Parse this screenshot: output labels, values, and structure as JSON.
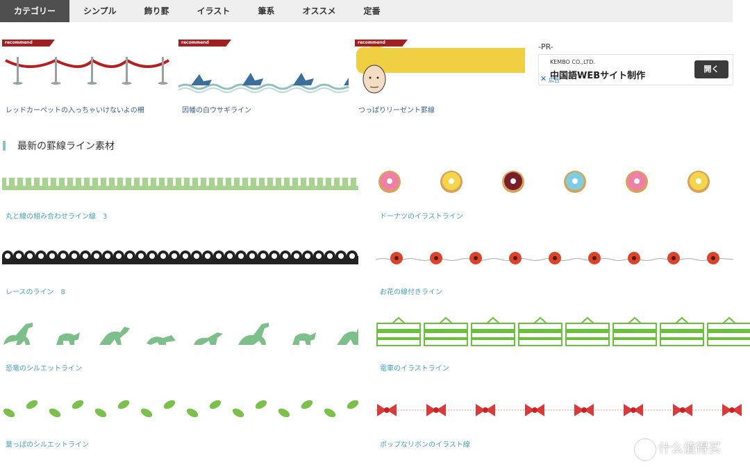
{
  "nav": {
    "items": [
      {
        "label": "カテゴリー",
        "active": true
      },
      {
        "label": "シンプル"
      },
      {
        "label": "飾り罫"
      },
      {
        "label": "イラスト"
      },
      {
        "label": "筆系"
      },
      {
        "label": "オススメ"
      },
      {
        "label": "定番"
      }
    ]
  },
  "recommended": {
    "badge": "recommend",
    "items": [
      {
        "title": "レッドカーペットの入っちゃいけないよの柵"
      },
      {
        "title": "因幡の白ウサギライン"
      },
      {
        "title": "つっぱりリーゼント罫線"
      }
    ]
  },
  "pr": {
    "label": "-PR-",
    "company": "KEMBO CO.,LTD.",
    "headline": "中国語WEBサイト制作",
    "open_button": "開く",
    "ad_label": "広告"
  },
  "section": {
    "title": "最新の罫線ライン素材"
  },
  "lines": [
    {
      "title": "丸と線の組み合わせライン線　3",
      "icon": "scallop-line",
      "color": "#a8d28f"
    },
    {
      "title": "ドーナツのイラストライン",
      "icon": "donut-line"
    },
    {
      "title": "レースのライン　8",
      "icon": "lace-line",
      "color": "#222222"
    },
    {
      "title": "お花の線付きライン",
      "icon": "flower-line",
      "color": "#d9442b"
    },
    {
      "title": "恐竜のシルエットライン",
      "icon": "dinosaur-line",
      "color": "#7dbf8a"
    },
    {
      "title": "電車のイラストライン",
      "icon": "train-line",
      "color": "#6abf3b"
    },
    {
      "title": "葉っぱのシルエットライン",
      "icon": "leaf-line",
      "color": "#7cc04c"
    },
    {
      "title": "ポップなリボンのイラスト線",
      "icon": "ribbon-line",
      "color": "#d93a3a"
    }
  ],
  "watermark": {
    "text": "什么值得买"
  }
}
